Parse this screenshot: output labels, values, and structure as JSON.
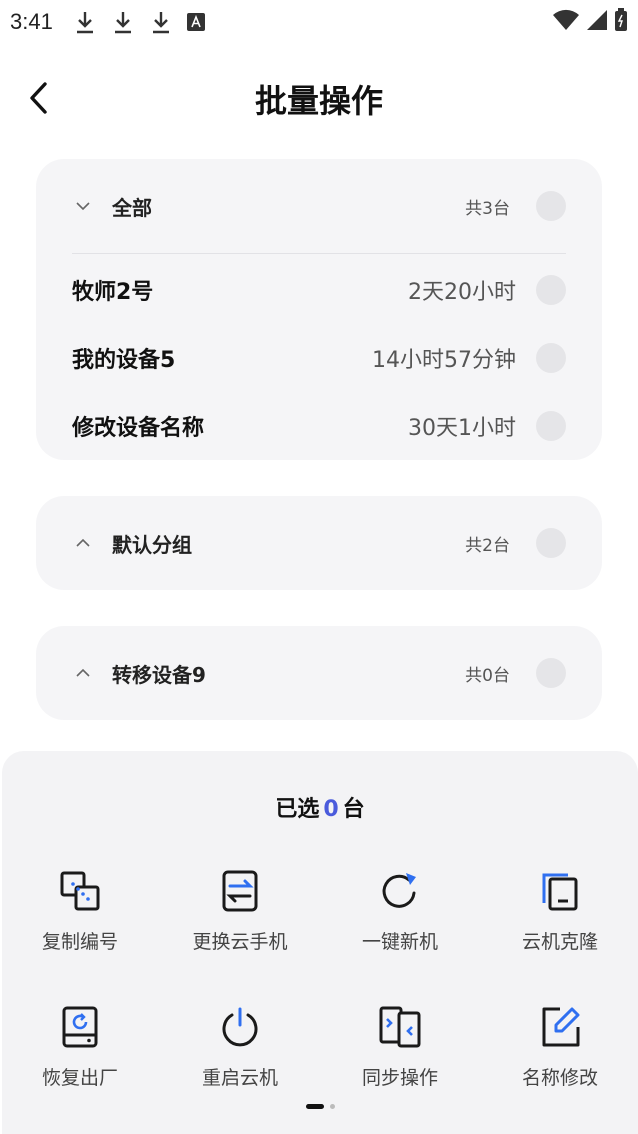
{
  "status_bar": {
    "time": "3:41",
    "icons": [
      "download-icon",
      "download-icon",
      "download-icon",
      "a-icon",
      "wifi-icon",
      "signal-icon",
      "battery-icon"
    ]
  },
  "header": {
    "title": "批量操作",
    "back_icon": "back-chevron-icon"
  },
  "groups": [
    {
      "name": "全部",
      "count": "共3台",
      "expanded": true,
      "devices": [
        {
          "name": "牧师2号",
          "time": "2天20小时"
        },
        {
          "name": "我的设备5",
          "time": "14小时57分钟"
        },
        {
          "name": "修改设备名称",
          "time": "30天1小时"
        }
      ]
    },
    {
      "name": "默认分组",
      "count": "共2台",
      "expanded": false
    },
    {
      "name": "转移设备9",
      "count": "共0台",
      "expanded": false
    }
  ],
  "sheet": {
    "selected_prefix": "已选",
    "selected_count": "0",
    "selected_suffix": "台",
    "actions": [
      {
        "label": "复制编号",
        "icon": "copy-id-icon"
      },
      {
        "label": "更换云手机",
        "icon": "swap-phone-icon"
      },
      {
        "label": "一键新机",
        "icon": "refresh-icon"
      },
      {
        "label": "云机克隆",
        "icon": "clone-icon"
      },
      {
        "label": "恢复出厂",
        "icon": "factory-reset-icon"
      },
      {
        "label": "重启云机",
        "icon": "power-icon"
      },
      {
        "label": "同步操作",
        "icon": "sync-icon"
      },
      {
        "label": "名称修改",
        "icon": "edit-icon"
      }
    ]
  },
  "colors": {
    "accent": "#4a5bdc",
    "accent_blue": "#2f6ff0",
    "card_bg": "#f5f5f7",
    "sheet_bg": "#f3f3f5"
  }
}
